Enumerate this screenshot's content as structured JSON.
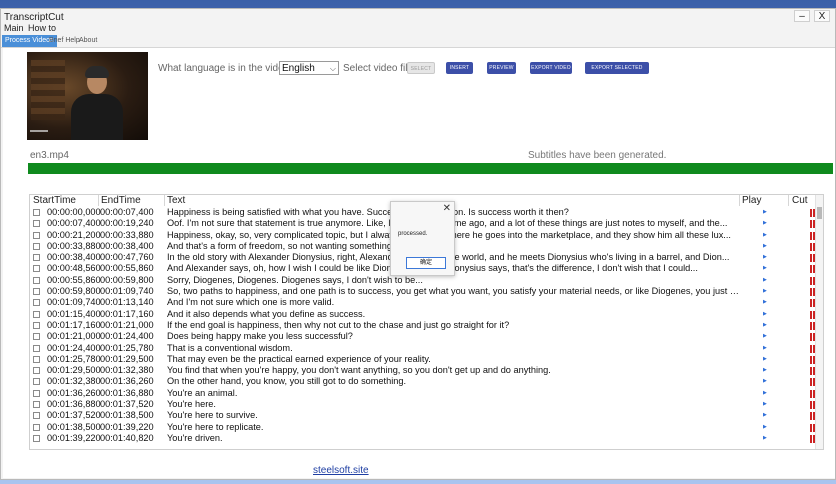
{
  "window": {
    "title": "TranscriptCut",
    "minimize_glyph": "–",
    "close_glyph": "X"
  },
  "menu": {
    "items": [
      "Main",
      "How to"
    ]
  },
  "tabs": [
    "Process Videos",
    "Brief Help",
    "About"
  ],
  "controls": {
    "question": "What language is in the video?",
    "language": "English",
    "select_label": "Select video file:",
    "buttons": [
      "SELECT",
      "INSERT",
      "PREVIEW",
      "EXPORT VIDEO",
      "EXPORT SELECTED CLIPS"
    ]
  },
  "video": {
    "filename": "en3.mp4"
  },
  "status": "Subtitles have been generated.",
  "progress": {
    "value": 1.0,
    "color": "#0f8a1e"
  },
  "table": {
    "headers": [
      "StartTime",
      "EndTime",
      "Text",
      "Play",
      "Cut"
    ],
    "rows": [
      {
        "start": "00:00:00,000",
        "end": "00:00:07,400",
        "text": "Happiness is being satisfied with what you have. Success co... ...sfaction. Is success worth it then?"
      },
      {
        "start": "00:00:07,400",
        "end": "00:00:19,240",
        "text": "Oof. I'm not sure that statement is true anymore. Like, I made ... long time ago, and a lot of these things are just notes to myself, and the..."
      },
      {
        "start": "00:00:21,200",
        "end": "00:00:33,880",
        "text": "Happiness, okay, so, very complicated topic, but I always lik... ...ory, where he goes into the marketplace, and they show him all these lux..."
      },
      {
        "start": "00:00:33,880",
        "end": "00:00:38,400",
        "text": "And that's a form of freedom, so not wanting something is as..."
      },
      {
        "start": "00:00:38,400",
        "end": "00:00:47,760",
        "text": "In the old story with Alexander Dionysius, right, Alexander go... ...ers the world, and he meets Dionysius who's living in a barrel, and Dion..."
      },
      {
        "start": "00:00:48,560",
        "end": "00:00:55,860",
        "text": "And Alexander says, oh, how I wish I could be like Dionysius ... ...nd Dionysius says, that's the difference, I don't wish that I could..."
      },
      {
        "start": "00:00:55,860",
        "end": "00:00:59,800",
        "text": "Sorry, Diogenes, Diogenes. Diogenes says, I don't wish to be..."
      },
      {
        "start": "00:00:59,800",
        "end": "00:01:09,740",
        "text": "So, two paths to happiness, and one path is to success, you get what you want, you satisfy your material needs, or like Diogenes, you just don't want i..."
      },
      {
        "start": "00:01:09,740",
        "end": "00:01:13,140",
        "text": "And I'm not sure which one is more valid."
      },
      {
        "start": "00:01:15,400",
        "end": "00:01:17,160",
        "text": "And it also depends what you define as success."
      },
      {
        "start": "00:01:17,160",
        "end": "00:01:21,000",
        "text": "If the end goal is happiness, then why not cut to the chase and just go straight for it?"
      },
      {
        "start": "00:01:21,000",
        "end": "00:01:24,400",
        "text": "Does being happy make you less successful?"
      },
      {
        "start": "00:01:24,400",
        "end": "00:01:25,780",
        "text": "That is a conventional wisdom."
      },
      {
        "start": "00:01:25,780",
        "end": "00:01:29,500",
        "text": "That may even be the practical earned experience of your reality."
      },
      {
        "start": "00:01:29,500",
        "end": "00:01:32,380",
        "text": "You find that when you're happy, you don't want anything, so you don't get up and do anything."
      },
      {
        "start": "00:01:32,380",
        "end": "00:01:36,260",
        "text": "On the other hand, you know, you still got to do something."
      },
      {
        "start": "00:01:36,260",
        "end": "00:01:36,880",
        "text": "You're an animal."
      },
      {
        "start": "00:01:36,880",
        "end": "00:01:37,520",
        "text": "You're here."
      },
      {
        "start": "00:01:37,520",
        "end": "00:01:38,500",
        "text": "You're here to survive."
      },
      {
        "start": "00:01:38,500",
        "end": "00:01:39,220",
        "text": "You're here to replicate."
      },
      {
        "start": "00:01:39,220",
        "end": "00:01:40,820",
        "text": "You're driven."
      }
    ],
    "play_glyph": "▶"
  },
  "dialog": {
    "message": "processed.",
    "ok_label": "确定",
    "close_glyph": "✕"
  },
  "footer": {
    "link": "steelsoft.site"
  },
  "colors": {
    "accent": "#4a8fd8",
    "button": "#3c4fa8",
    "progress": "#0f8a1e",
    "cut": "#cc2222"
  }
}
